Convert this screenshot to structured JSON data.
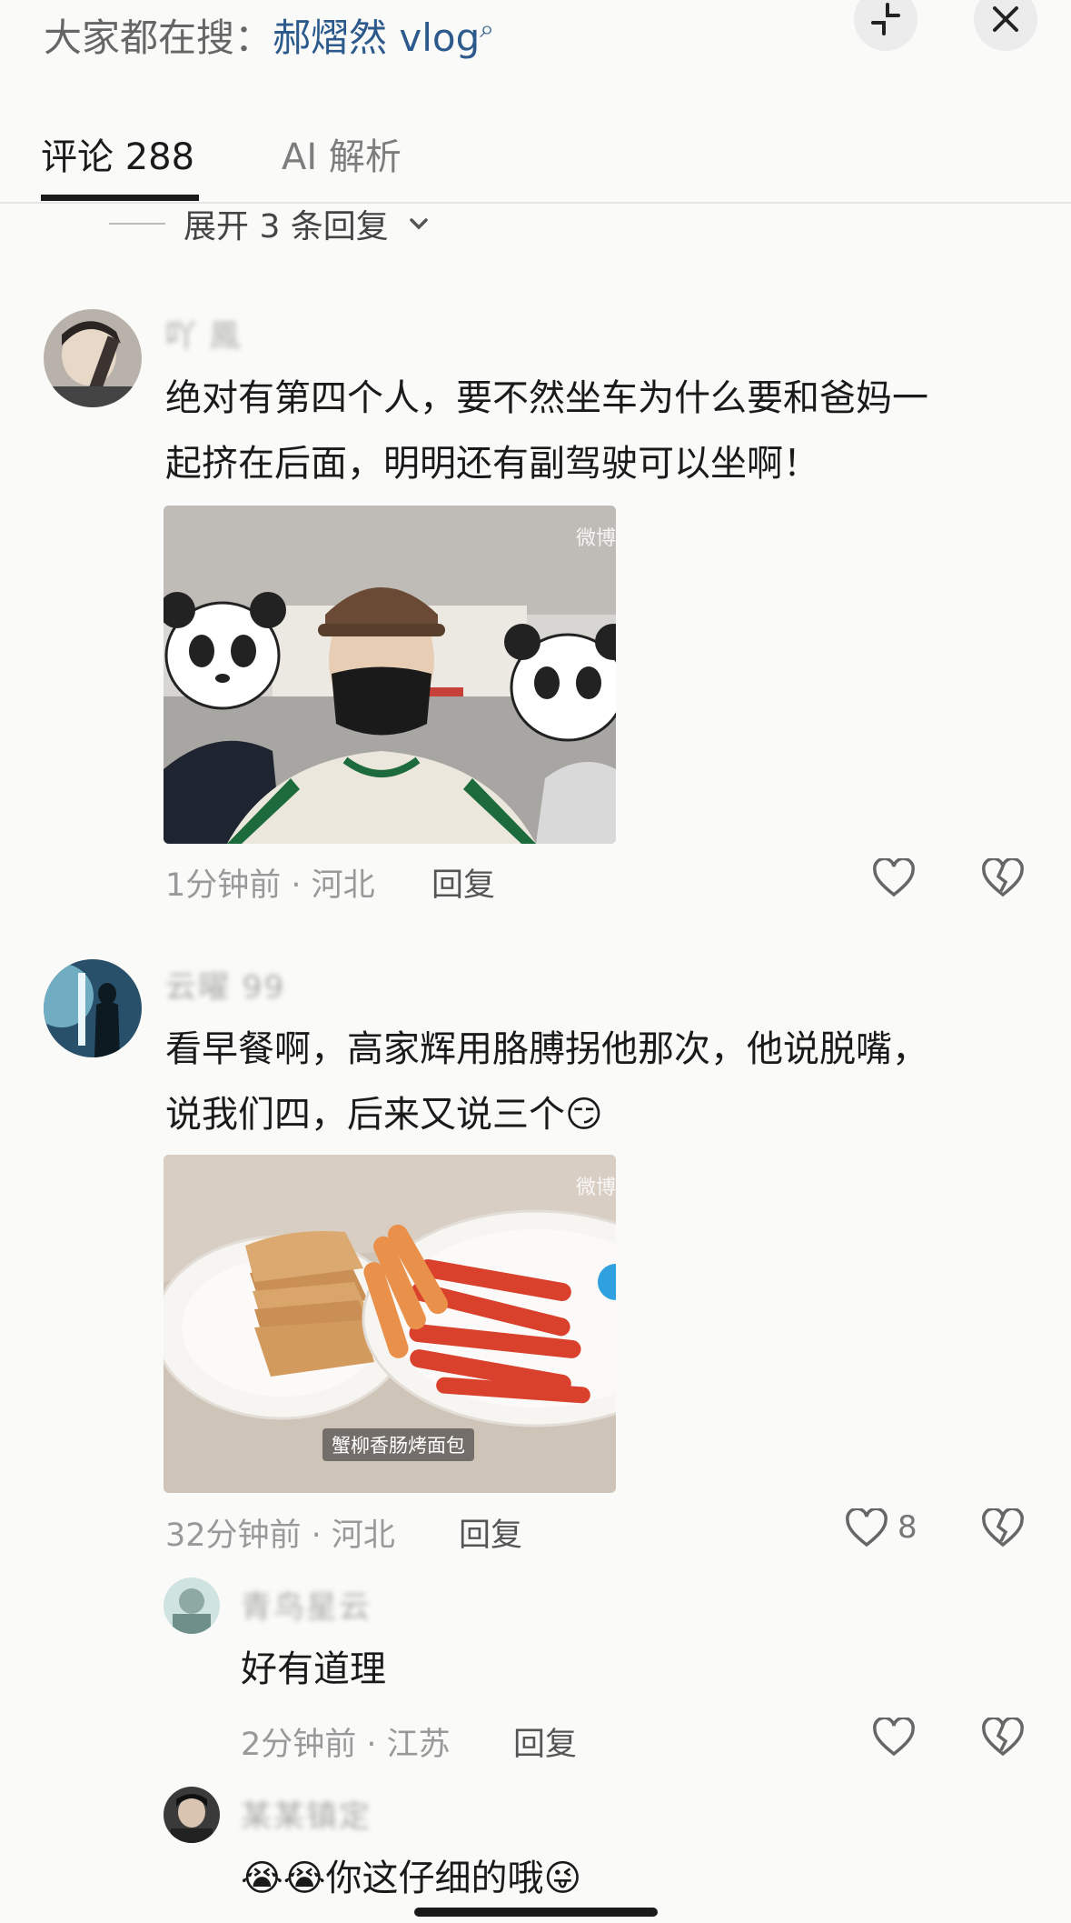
{
  "header": {
    "search_prefix": "大家都在搜：",
    "search_keyword": "郝熠然 vlog",
    "collapse_icon": "collapse-icon",
    "close_icon": "close-icon"
  },
  "tabs": [
    {
      "label": "评论 288",
      "active": true
    },
    {
      "label": "AI 解析",
      "active": false
    }
  ],
  "expand_replies": "展开 3 条回复",
  "comments": [
    {
      "username": "吖 鳯",
      "text_line1": "绝对有第四个人，要不然坐车为什么要和爸妈一",
      "text_line2": "起挤在后面，明明还有副驾驶可以坐啊！",
      "image_watermark": "微博",
      "time_location": "1分钟前 · 河北",
      "reply": "回复",
      "like_count": ""
    },
    {
      "username": "云曜 99",
      "text_line1": "看早餐啊，高家辉用胳膊拐他那次，他说脱嘴，",
      "text_line2": "说我们四，后来又说三个",
      "emoji": "😏",
      "image_watermark": "微博",
      "image_caption": "蟹柳香肠烤面包",
      "time_location": "32分钟前 · 河北",
      "reply": "回复",
      "like_count": "8"
    }
  ],
  "replies": [
    {
      "username": "青鸟星云",
      "text": "好有道理",
      "time_location": "2分钟前 · 江苏",
      "reply": "回复"
    },
    {
      "username": "某某镇定",
      "text": "你这仔细的哦",
      "emoji_before": "😭😭",
      "emoji_after": "😜"
    }
  ],
  "colors": {
    "background": "#fafaf8",
    "keyword": "#2c5a8c",
    "meta": "#999999"
  }
}
